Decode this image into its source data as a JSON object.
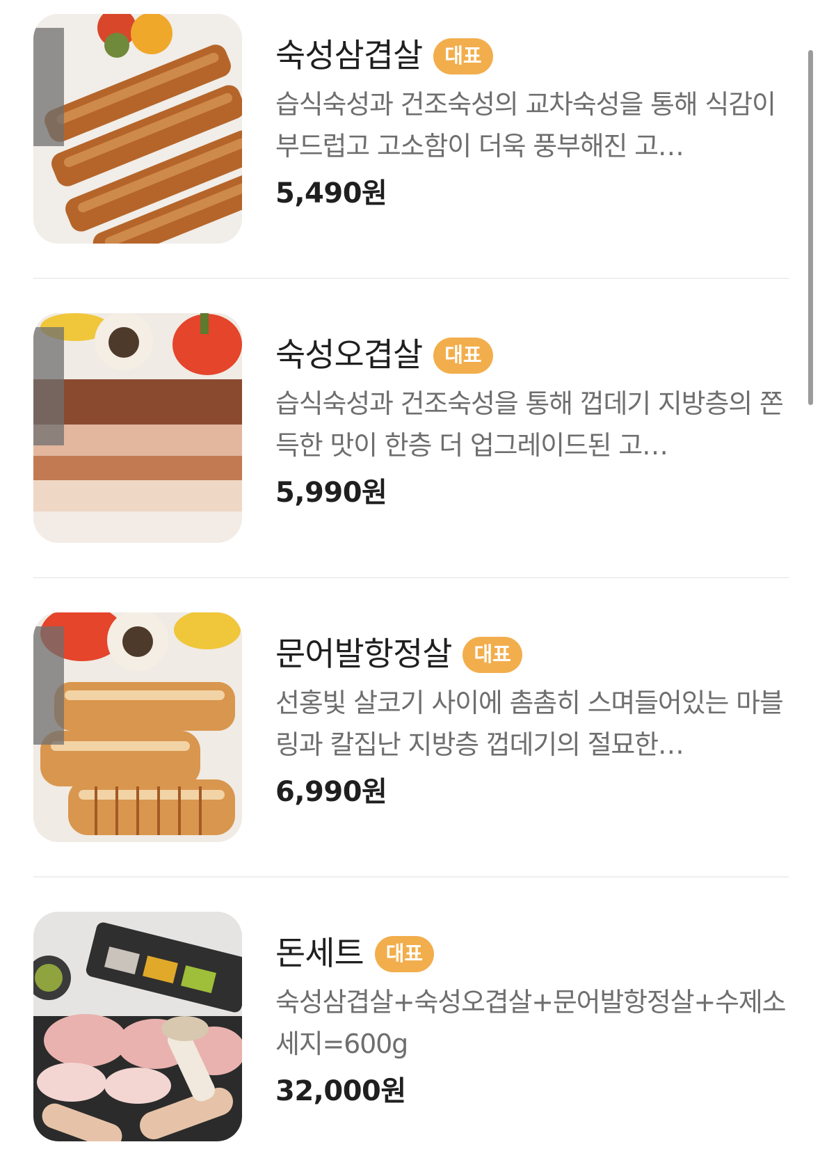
{
  "menu": {
    "items": [
      {
        "name": "숙성삼겹살",
        "badge": "대표",
        "description": "습식숙성과 건조숙성의 교차숙성을 통해 식감이 부드럽고 고소함이 더욱 풍부해진 고…",
        "price": "5,490원",
        "image": "grilled-pork-belly-photo"
      },
      {
        "name": "숙성오겹살",
        "badge": "대표",
        "description": "습식숙성과 건조숙성을 통해 껍데기 지방층의 쫀득한 맛이 한층 더 업그레이드된 고…",
        "price": "5,990원",
        "image": "grilled-pork-five-layer-photo"
      },
      {
        "name": "문어발항정살",
        "badge": "대표",
        "description": "선홍빛 살코기 사이에 촘촘히 스며들어있는 마블링과 칼집난 지방층 껍데기의 절묘한…",
        "price": "6,990원",
        "image": "grilled-pork-jowl-photo"
      },
      {
        "name": "돈세트",
        "badge": "대표",
        "description": "숙성삼겹살+숙성오겹살+문어발항정살+수제소세지=600g",
        "price": "32,000원",
        "image": "raw-pork-set-platter-photo"
      }
    ]
  },
  "colors": {
    "badge": "#f2ae4c",
    "title": "#1f1f1f",
    "description": "#6e6e6e",
    "divider": "#efefef"
  }
}
